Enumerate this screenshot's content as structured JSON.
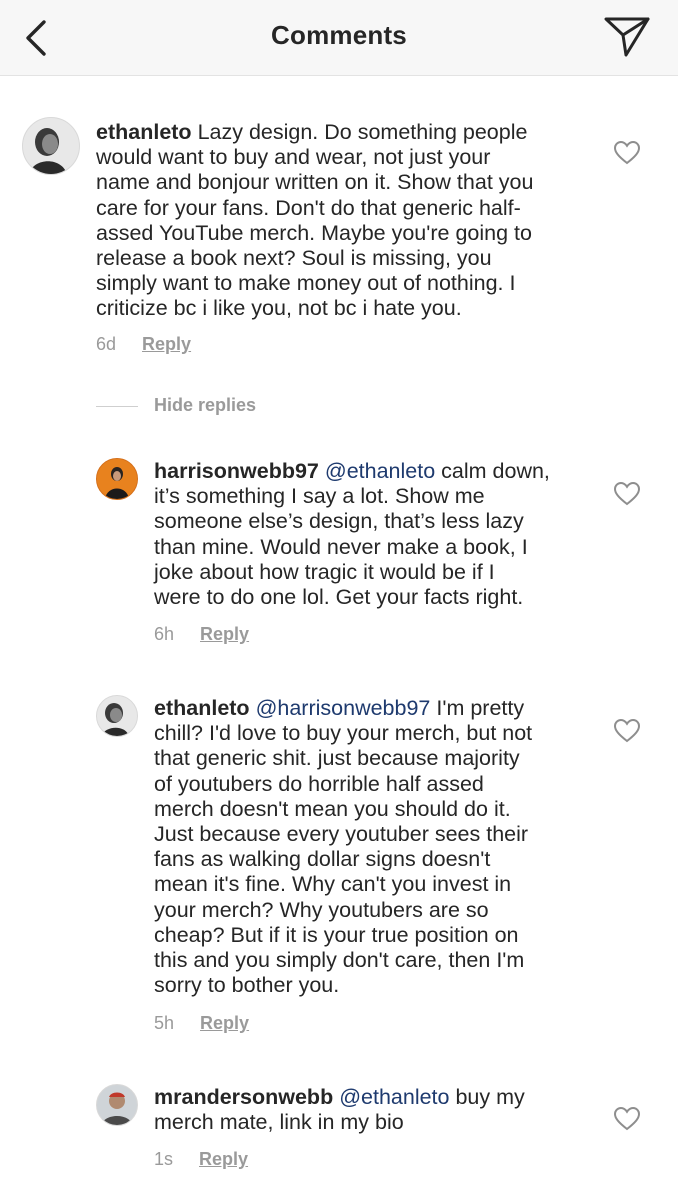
{
  "header": {
    "title": "Comments",
    "back_icon": "chevron-left-icon",
    "share_icon": "paper-plane-icon"
  },
  "comments": [
    {
      "username": "ethanleto",
      "mention": "",
      "lines": [
        "Lazy design. Do something people",
        "would want to buy and wear, not just your",
        "name and bonjour written on it. Show that you",
        "care for your fans. Don't do that generic half-",
        "assed YouTube merch. Maybe you're going to",
        "release a book next? Soul is missing, you",
        "simply want to make money out of nothing. I",
        "criticize bc i like you, not bc i hate you."
      ],
      "time": "6d",
      "reply_label": "Reply"
    },
    {
      "username": "harrisonwebb97",
      "mention": "@ethanleto",
      "lines": [
        "calm down,",
        "it’s something I say a lot. Show me",
        "someone else’s design, that’s less lazy",
        "than mine. Would never make a book, I",
        "joke about how tragic it would be if I",
        "were to do one lol. Get your facts right."
      ],
      "time": "6h",
      "reply_label": "Reply"
    },
    {
      "username": "ethanleto",
      "mention": "@harrisonwebb97",
      "lines": [
        "I'm pretty",
        "chill? I'd love to buy your merch, but not",
        "that generic shit. just because majority",
        "of youtubers do horrible half assed",
        "merch doesn't mean you should do it.",
        "Just because every youtuber sees their",
        "fans as walking dollar signs doesn't",
        "mean it's fine. Why can't you invest in",
        "your merch? Why youtubers are so",
        "cheap? But if it is your true position on",
        "this and you simply don't care, then I'm",
        "sorry to bother you."
      ],
      "time": "5h",
      "reply_label": "Reply"
    },
    {
      "username": "mrandersonwebb",
      "mention": "@ethanleto",
      "lines": [
        "buy my",
        "merch mate, link in my bio"
      ],
      "time": "1s",
      "reply_label": "Reply"
    }
  ],
  "hide_replies_label": "Hide replies",
  "colors": {
    "mention": "#1e3a6e",
    "muted": "#9a9a9a",
    "header_bg": "#f7f7f7"
  }
}
